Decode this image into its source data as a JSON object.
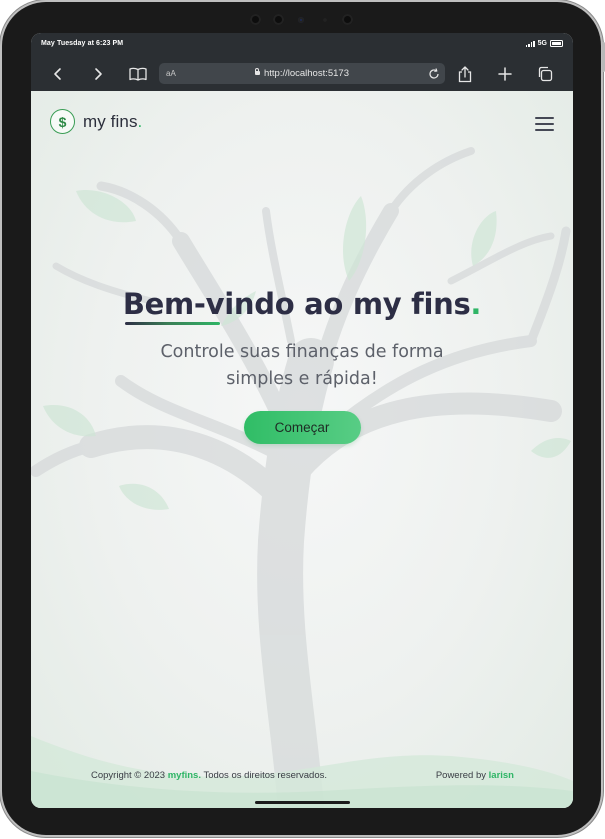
{
  "status_bar": {
    "time": "May Tuesday at 6:23 PM",
    "network": "5G"
  },
  "browser": {
    "text_size_label": "aA",
    "url": "http://localhost:5173",
    "icons": [
      "back-icon",
      "forward-icon",
      "bookmarks-icon",
      "lock-icon",
      "reload-icon",
      "share-icon",
      "new-tab-icon",
      "tabs-icon"
    ]
  },
  "header": {
    "logo_symbol": "$",
    "brand_name": "my fins",
    "brand_dot": ".",
    "menu_icon": "hamburger-menu-icon"
  },
  "hero": {
    "title_main": "Bem-vindo ao my fins",
    "title_dot": ".",
    "subtitle": "Controle suas finanças de forma simples e rápida!",
    "cta_label": "Começar"
  },
  "footer": {
    "copyright_prefix": "Copyright © 2023",
    "copyright_brand": "myfins.",
    "copyright_suffix": "Todos os direitos reservados.",
    "powered_prefix": "Powered by",
    "powered_brand": "larisn"
  },
  "colors": {
    "accent": "#2fb566",
    "text_dark": "#2d2e45",
    "text_muted": "#5d616a",
    "browser_chrome": "#2b2f33"
  }
}
